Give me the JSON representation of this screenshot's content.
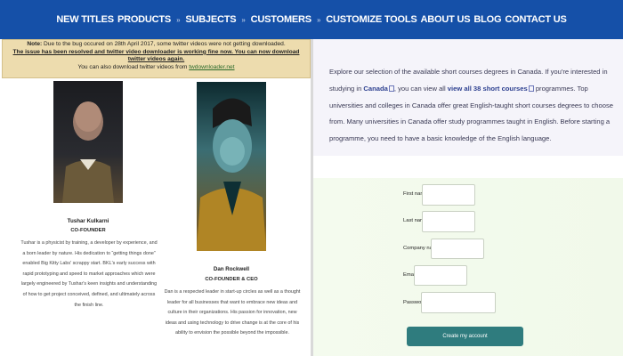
{
  "nav": {
    "items": [
      "NEW TITLES",
      "PRODUCTS",
      "SUBJECTS",
      "CUSTOMERS",
      "CUSTOMIZE TOOLS",
      "ABOUT US",
      "BLOG",
      "CONTACT US"
    ],
    "sep": "»"
  },
  "notice": {
    "line1_bold": "Note:",
    "line1": " Due to the bug occured on 28th April 2017, some twitter videos were not getting downloaded.",
    "line2": "The issue has been resolved and twitter video downloader is working fine now. You can now download twitter videos again.",
    "line3": "You can also download twitter videos from ",
    "line3_link": "twdownloader.net"
  },
  "team": [
    {
      "name": "Tushar Kulkarni",
      "role": "CO-FOUNDER",
      "bio": "Tushar is a physicist by training, a developer by experience, and a born leader by nature. His dedication to “getting things done” enabled Big Kitty Labs' scrappy start. BKL's early success with rapid prototyping and speed to market approaches which were largely engineered by Tushar's keen insights and understanding of how to get project conceived, defined, and ultimately across the finish line."
    },
    {
      "name": "Dan Rockwell",
      "role": "CO-FOUNDER & CEO",
      "bio": "Dan is a respected leader in start-up circles as well as a thought leader for all businesses that want to embrace new ideas and culture in their organizations. His passion for innovation, new ideas and using technology to drive change is at the core of his ability to envision the possible beyond the impossible."
    }
  ],
  "intro": {
    "p1": "Explore our selection of the available short courses degrees in Canada. If you're interested in studying in ",
    "link1": "Canada",
    "p2": ", you can view all ",
    "link2": "view all 38 short courses",
    "p3": " programmes. Top universities and colleges in Canada offer great English-taught short courses degrees to choose from. Many universities in Canada offer study programmes taught in English. Before starting a programme, you need to have a basic knowledge of the English language."
  },
  "form": {
    "first_name": "First name",
    "last_name": "Last name",
    "company_name": "Company name",
    "email": "Email",
    "password": "Password",
    "submit": "Create my account"
  },
  "colors": {
    "nav_bg": "#1550a8",
    "button_bg": "#2f7c7e"
  }
}
